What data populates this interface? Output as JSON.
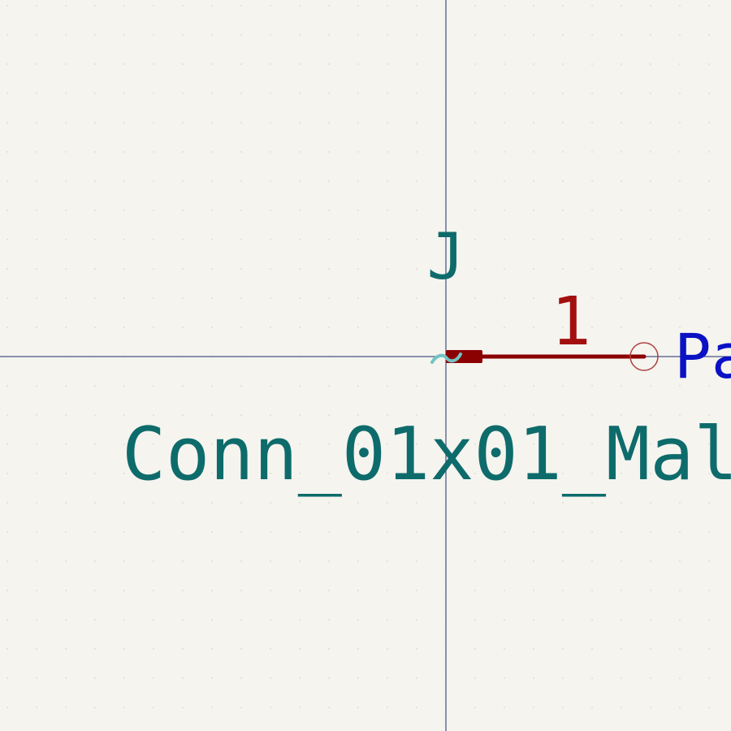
{
  "editor": {
    "app": "schematic-symbol-editor",
    "background_color": "#f5f4ef",
    "grid_dot_color": "#c9c9c3",
    "crosshair_color": "#1a2b6b"
  },
  "symbol": {
    "reference": "J",
    "value": "Conn_01x01_Mal",
    "field_color": "#0e6b6b",
    "body_color": "#8b0000"
  },
  "pin": {
    "number": "1",
    "name_label": "Pa",
    "line_color": "#8b0000",
    "number_color": "#a30f0f",
    "name_color": "#0b12c4",
    "endpoint_circle_color": "#b04040"
  },
  "anchor_marker": {
    "icon": "tilde-anchor-icon",
    "color": "#73c3c3"
  }
}
